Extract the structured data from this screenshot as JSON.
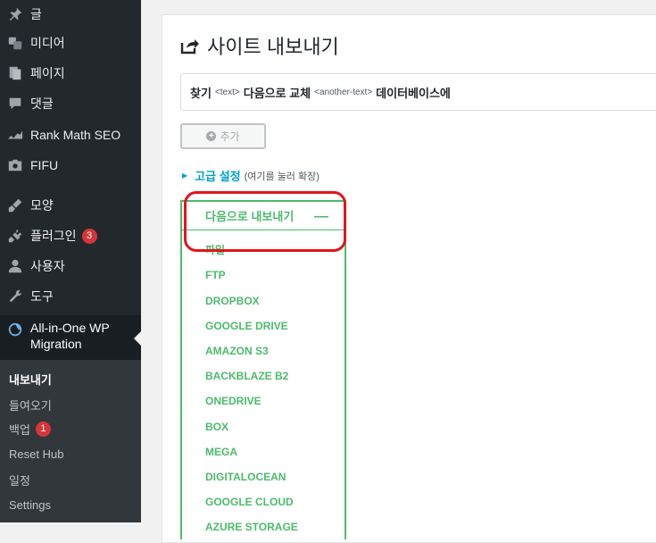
{
  "sidebar": {
    "items": [
      {
        "label": "글",
        "icon": "pushpin-icon"
      },
      {
        "label": "미디어",
        "icon": "media-icon"
      },
      {
        "label": "페이지",
        "icon": "pages-icon"
      },
      {
        "label": "댓글",
        "icon": "comments-icon"
      },
      {
        "label": "Rank Math SEO",
        "icon": "rank-math-icon"
      },
      {
        "label": "FIFU",
        "icon": "camera-icon"
      },
      {
        "label": "모양",
        "icon": "appearance-icon"
      },
      {
        "label": "플러그인",
        "icon": "plugins-icon",
        "badge": "3"
      },
      {
        "label": "사용자",
        "icon": "users-icon"
      },
      {
        "label": "도구",
        "icon": "tools-icon"
      }
    ],
    "active": {
      "line1": "All-in-One WP",
      "line2": "Migration",
      "icon": "migration-icon"
    },
    "submenu": [
      {
        "label": "내보내기"
      },
      {
        "label": "들여오기"
      },
      {
        "label": "백업",
        "badge": "1"
      },
      {
        "label": "Reset Hub"
      },
      {
        "label": "일정"
      },
      {
        "label": "Settings"
      }
    ]
  },
  "main": {
    "title": "사이트 내보내기",
    "replace": {
      "find": "찾기",
      "placeholder1": "<text>",
      "middle": "다음으로 교체",
      "placeholder2": "<another-text>",
      "suffix": "데이터베이스에"
    },
    "add_label": "추가",
    "advanced": {
      "label": "고급 설정",
      "hint": "(여기를 눌러 확장)"
    },
    "export_menu": {
      "header": "다음으로 내보내기",
      "items": [
        "파일",
        "FTP",
        "DROPBOX",
        "GOOGLE DRIVE",
        "AMAZON S3",
        "BACKBLAZE B2",
        "ONEDRIVE",
        "BOX",
        "MEGA",
        "DIGITALOCEAN",
        "GOOGLE CLOUD",
        "AZURE STORAGE"
      ]
    }
  },
  "colors": {
    "sidebar_bg": "#23282d",
    "accent_green": "#4cbb6c",
    "link_blue": "#00a0d2",
    "highlight_red": "#e2141c",
    "badge_red": "#d63638"
  }
}
